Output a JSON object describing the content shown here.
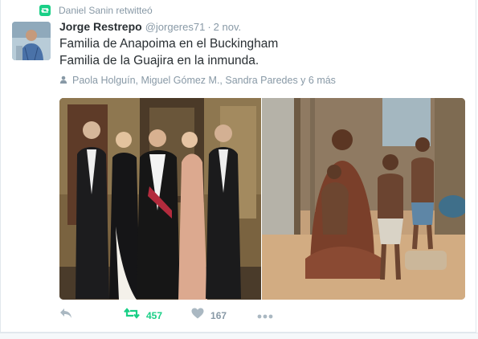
{
  "retweet_context": {
    "text": "Daniel Sanin retwitteó",
    "icon": "retweet-icon"
  },
  "tweet": {
    "fullname": "Jorge Restrepo",
    "username": "@jorgeres71",
    "separator": "·",
    "time": "2 nov.",
    "text_line1": "Familia de Anapoima en el Buckingham",
    "text_line2": "Familia de la Guajira en la inmunda.",
    "tagged": "Paola Holguín, Miguel Gómez M., Sandra Paredes y 6 más",
    "tagged_icon": "person-icon"
  },
  "actions": {
    "reply_icon": "reply-icon",
    "retweet_icon": "retweet-icon",
    "retweet_count": "457",
    "like_icon": "heart-icon",
    "like_count": "167",
    "more_icon": "more-icon"
  },
  "colors": {
    "retweet_green": "#19cf86",
    "muted": "#8899a6",
    "text": "#292f33",
    "border": "#e1e8ed"
  }
}
